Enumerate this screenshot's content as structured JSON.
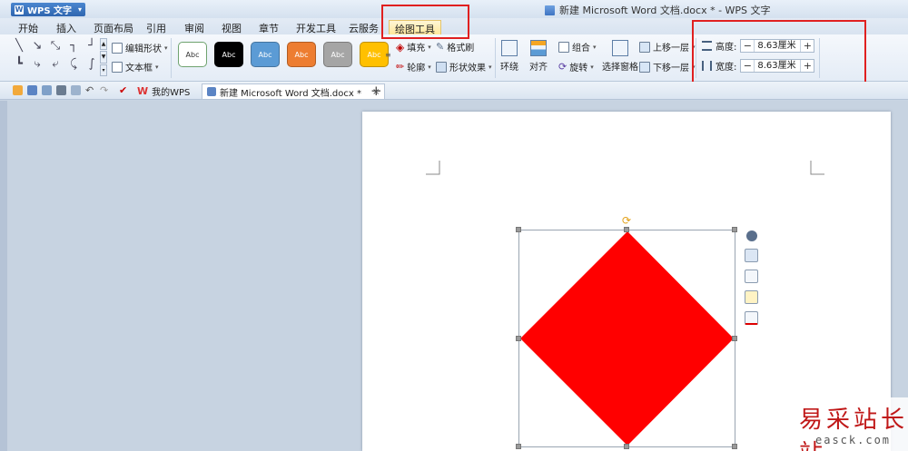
{
  "app": {
    "name": "WPS 文字",
    "title": "新建 Microsoft Word 文档.docx * - WPS 文字"
  },
  "menu": {
    "tabs": [
      "开始",
      "插入",
      "页面布局",
      "引用",
      "审阅",
      "视图",
      "章节",
      "开发工具",
      "云服务",
      "绘图工具"
    ],
    "active": "绘图工具"
  },
  "ribbon": {
    "edit_shape": "编辑形状",
    "text_box": "文本框",
    "style_label": "Abc",
    "style_colors": [
      "#ffffff",
      "#000000",
      "#5b9bd5",
      "#ed7d31",
      "#a5a5a5",
      "#ffc000"
    ],
    "fill": "填充",
    "format_brush": "格式刷",
    "outline": "轮廓",
    "shape_effect": "形状效果",
    "wrap": "环绕",
    "align": "对齐",
    "group": "组合",
    "rotate": "旋转",
    "select_pane": "选择窗格",
    "bring_forward": "上移一层",
    "send_backward": "下移一层",
    "height_label": "高度:",
    "height_value": "8.63厘米",
    "width_label": "宽度:",
    "width_value": "8.63厘米",
    "minus": "−",
    "plus": "+"
  },
  "doc_tabs": {
    "my_wps": "我的WPS",
    "doc": "新建 Microsoft Word 文档.docx *",
    "close": "×",
    "add": "+"
  },
  "shape": {
    "fill": "#ff0000"
  },
  "watermark": {
    "main": "易采站长站",
    "sub": "easck.com"
  }
}
